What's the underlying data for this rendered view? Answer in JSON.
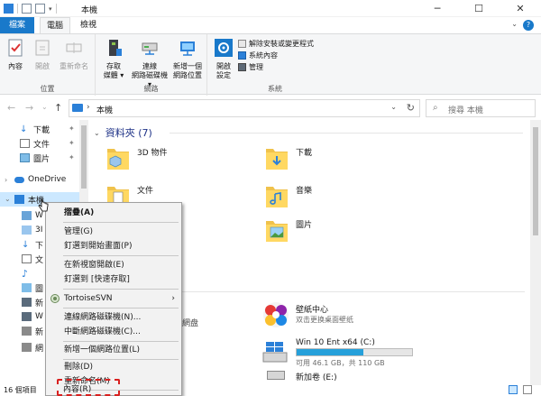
{
  "window": {
    "title": "本機",
    "minimize": "─",
    "maximize": "☐",
    "close": "✕"
  },
  "ribbon_tabs": {
    "file": "檔案",
    "computer": "電腦",
    "view": "檢視",
    "help": "?"
  },
  "ribbon": {
    "location_group": {
      "label": "位置",
      "properties": "內容",
      "open": "開啟",
      "rename": "重新命名"
    },
    "network_group": {
      "label": "網路",
      "access_media": [
        "存取",
        "媒體"
      ],
      "map_drive": [
        "連線",
        "網路磁碟機"
      ],
      "add_location": [
        "新增一個",
        "網路位置"
      ]
    },
    "system_group": {
      "label": "系統",
      "open_settings": [
        "開啟",
        "設定"
      ],
      "uninstall": "解除安裝或變更程式",
      "system_properties": "系統內容",
      "manage": "管理"
    }
  },
  "navigation": {
    "back": "←",
    "forward": "→",
    "up": "↑",
    "address_crumb": "本機",
    "search_placeholder": "搜尋 本機"
  },
  "nav_pane": {
    "pinned": [
      {
        "label": "下載"
      },
      {
        "label": "文件"
      },
      {
        "label": "圖片"
      }
    ],
    "onedrive": "OneDrive",
    "this_pc": "本機",
    "truncated": [
      "W",
      "3I",
      "下",
      "文",
      "♪",
      "圖",
      "新",
      "W",
      "新",
      "網"
    ]
  },
  "content": {
    "section_title": "資料夾 (7)",
    "folders": [
      {
        "label": "3D 物件"
      },
      {
        "label": "下載"
      },
      {
        "label": "文件"
      },
      {
        "label": "音樂"
      },
      {
        "label": "圖片"
      }
    ],
    "partial_label": "網盘",
    "wallpaper_center": {
      "title": "壁紙中心",
      "subtitle": "双击更换桌面壁纸"
    },
    "drive_c": {
      "label": "Win 10 Ent x64 (C:)",
      "free": "可用 46.1 GB，共 110 GB",
      "used_fraction": 0.58
    },
    "drive_e": {
      "label": "新加卷 (E:)"
    }
  },
  "status_bar": {
    "count": "16 個項目"
  },
  "context_menu": {
    "items": [
      {
        "label": "摺疊(A)",
        "bold": true
      },
      {
        "label": "管理(G)"
      },
      {
        "label": "釘選到開始畫面(P)"
      },
      {
        "label": "在新視窗開啟(E)"
      },
      {
        "label": "釘選到 [快速存取]"
      },
      {
        "label": "TortoiseSVN",
        "submenu": "›"
      },
      {
        "label": "連線網路磁碟機(N)..."
      },
      {
        "label": "中斷網路磁碟機(C)..."
      },
      {
        "label": "新增一個網路位置(L)"
      },
      {
        "label": "刪除(D)"
      },
      {
        "label": "重新命名(M)"
      },
      {
        "label": "內容(R)"
      }
    ]
  },
  "colors": {
    "accent": "#1979ca",
    "folder": "#f0c24b",
    "highlight": "#d9201f"
  }
}
